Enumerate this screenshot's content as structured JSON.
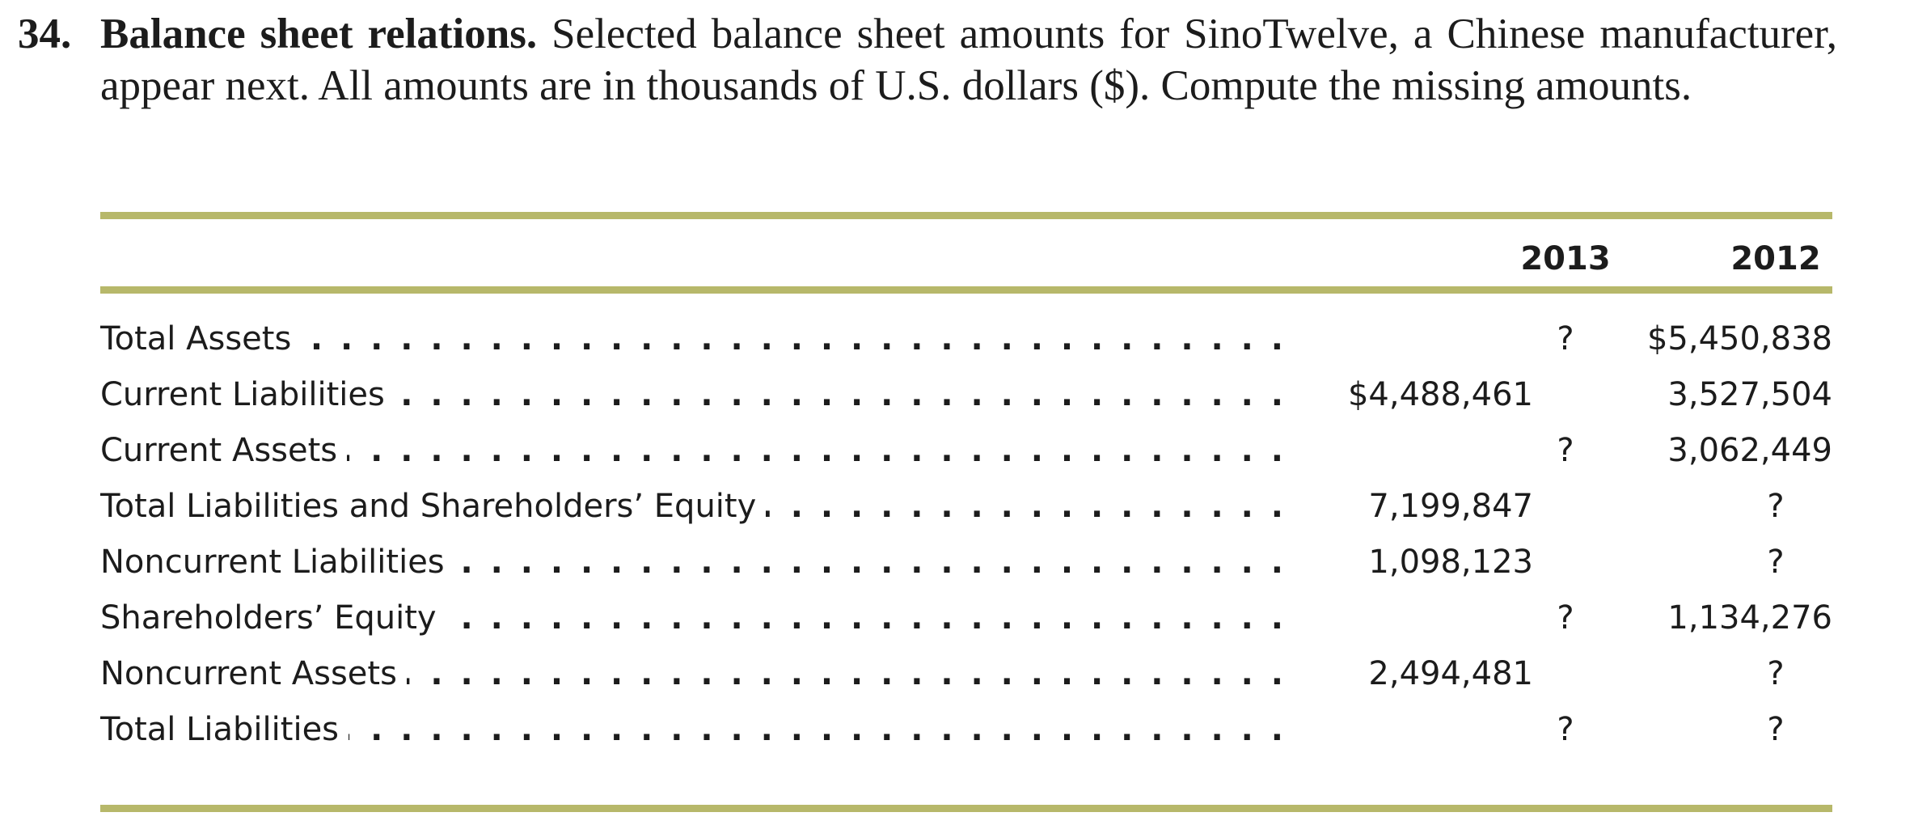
{
  "problem": {
    "number": "34.",
    "title": "Balance sheet relations.",
    "text": " Selected balance sheet amounts for SinoTwelve, a Chinese manu­facturer, appear next. All amounts are in thousands of U.S. dollars ($). Compute the miss­ing amounts."
  },
  "table": {
    "headers": {
      "col_2013": "2013",
      "col_2012": "2012"
    },
    "rows": [
      {
        "label": "Total Assets",
        "y2013": "?",
        "y2012": "$5,450,838"
      },
      {
        "label": "Current Liabilities",
        "y2013": "$4,488,461",
        "y2012": "3,527,504"
      },
      {
        "label": "Current Assets",
        "y2013": "?",
        "y2012": "3,062,449"
      },
      {
        "label": "Total Liabilities and Shareholders’ Equity",
        "y2013": "7,199,847",
        "y2012": "?"
      },
      {
        "label": "Noncurrent Liabilities",
        "y2013": "1,098,123",
        "y2012": "?"
      },
      {
        "label": "Shareholders’ Equity",
        "y2013": "?",
        "y2012": "1,134,276"
      },
      {
        "label": "Noncurrent Assets",
        "y2013": "2,494,481",
        "y2012": "?"
      },
      {
        "label": "Total Liabilities",
        "y2013": "?",
        "y2012": "?"
      }
    ]
  },
  "colors": {
    "rule": "#b7b86a",
    "text": "#1c1c1c"
  }
}
